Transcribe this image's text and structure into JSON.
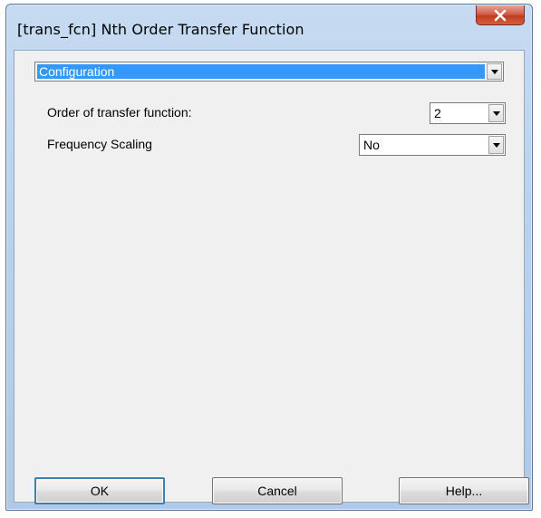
{
  "window": {
    "title": "[trans_fcn] Nth Order Transfer Function",
    "close_icon": "close-x-icon"
  },
  "section_select": {
    "value": "Configuration"
  },
  "fields": {
    "order": {
      "label": "Order of transfer function:",
      "value": "2"
    },
    "frequency_scaling": {
      "label": "Frequency Scaling",
      "value": "No"
    }
  },
  "buttons": {
    "ok": "OK",
    "cancel": "Cancel",
    "help": "Help..."
  },
  "colors": {
    "selection": "#3399ff",
    "close_button": "#c23d22",
    "title_bar": "#bad2ec"
  }
}
